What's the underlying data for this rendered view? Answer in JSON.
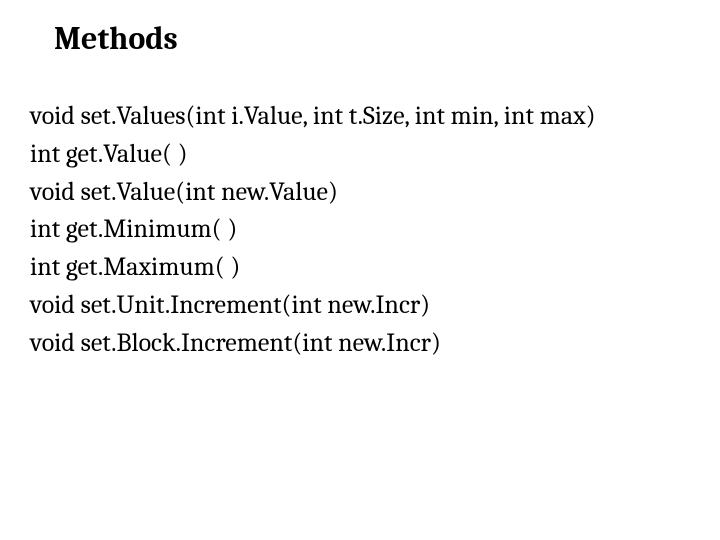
{
  "title": "Methods",
  "lines": [
    "void set.Values(int i.Value, int t.Size, int min, int max)",
    "int get.Value( )",
    "void set.Value(int new.Value)",
    "int get.Minimum( )",
    "int get.Maximum( )",
    "void set.Unit.Increment(int new.Incr)",
    "void set.Block.Increment(int new.Incr)"
  ]
}
